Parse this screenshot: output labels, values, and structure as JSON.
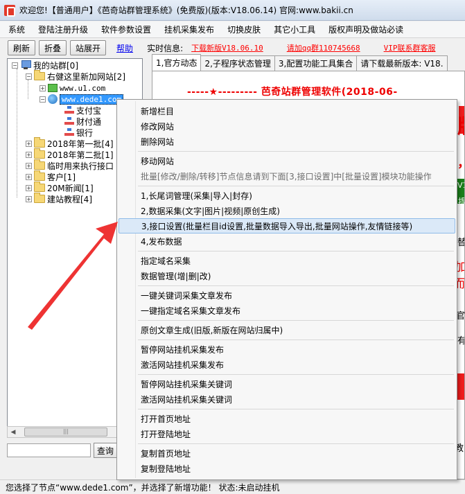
{
  "window": {
    "title": "欢迎您!【普通用户】《芭奇站群管理系统》(免费版)(版本:V18.06.14) 官网:www.bakii.cn"
  },
  "menubar": {
    "items": [
      "系统",
      "登陆注册升级",
      "软件参数设置",
      "挂机采集发布",
      "切换皮肤",
      "其它小工具",
      "版权声明及做站必读"
    ]
  },
  "toolbar": {
    "refresh": "刷新",
    "collapse": "折叠",
    "expand": "站展开",
    "help": "帮助",
    "info_label": "实时信息:",
    "links": [
      "下载新版V18.06.10",
      "请加qq群110745668",
      "VIP联系群客服"
    ]
  },
  "tree": {
    "root": "我的站群[0]",
    "group1": "右健这里新加网站[2]",
    "site1": "www.u1.com",
    "site2": "www.dede1.com",
    "node1": "支付宝",
    "node2": "财付通",
    "node3": "银行",
    "group2": "2018年第一批[4]",
    "group3": "2018年第二批[1]",
    "group4": "临时用来执行接口",
    "group5": "客户[1]",
    "group6": "20M新闻[1]",
    "group7": "建站教程[4]"
  },
  "search": {
    "button": "查询",
    "value": ""
  },
  "tabs": [
    "1,官方动态",
    "2,子程序状态管理",
    "3,配置功能工具集合",
    "请下载最新版本: V18."
  ],
  "content": {
    "banner": "-----★---------  芭奇站群管理软件(2018-06-",
    "fragments": [
      "版",
      "，",
      "V1",
      "提",
      "替",
      "加",
      "而产",
      "官",
      "有",
      "教"
    ]
  },
  "context_menu": {
    "items": [
      "新增栏目",
      "修改网站",
      "删除网站",
      "移动网站",
      "批量[修改/删除/转移]节点信息请到下面[3,接口设置]中[批量设置]模块功能操作",
      "1,长尾词管理(采集|导入|封存)",
      "2,数据采集(文字|图片|视频|原创生成)",
      "3,接口设置(批量栏目id设置,批量数据导入导出,批量网站操作,友情链接等)",
      "4,发布数据",
      "指定域名采集",
      "数据管理(增|删|改)",
      "一键关键词采集文章发布",
      "一键指定域名采集文章发布",
      "原创文章生成(旧版,新版在网站归属中)",
      "暂停网站挂机采集发布",
      "激活网站挂机采集发布",
      "暂停网站挂机采集关键词",
      "激活网站挂机采集关键词",
      "打开首页地址",
      "打开登陆地址",
      "复制首页地址",
      "复制登陆地址"
    ]
  },
  "statusbar": {
    "text": "您选择了节点“www.dede1.com”，并选择了新增功能！ 状态:未启动挂机"
  },
  "colors": {
    "accent_red": "#ee1c1c",
    "link_red": "#ff0000",
    "selection_blue": "#3399ff",
    "menu_highlight": "#dbe9f8"
  }
}
